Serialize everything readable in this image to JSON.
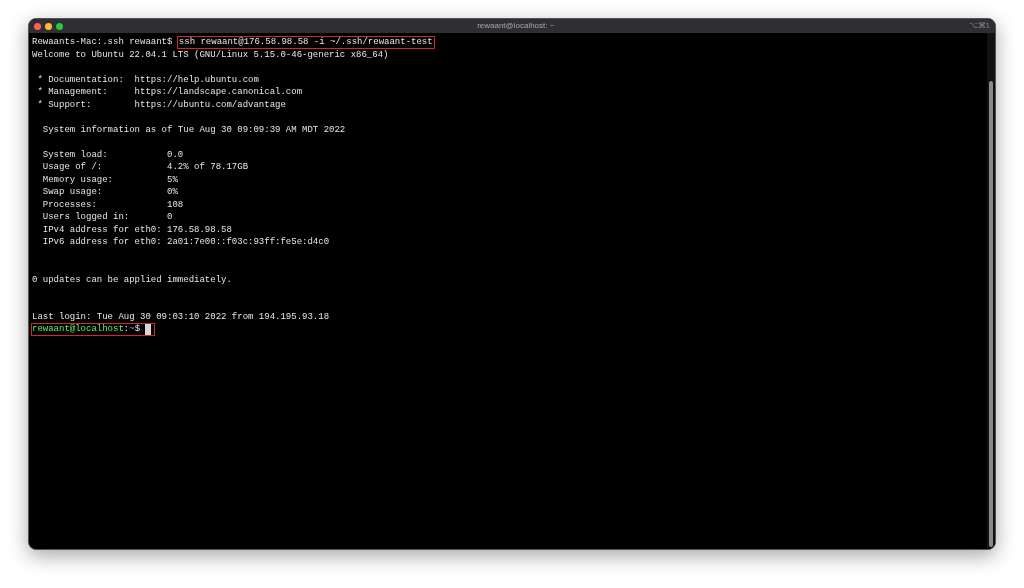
{
  "window": {
    "title": "rewaant@localhost: ~",
    "shortcut": "⌥⌘1"
  },
  "lines": [
    {
      "kind": "command",
      "prompt": "Rewaants-Mac:.ssh rewaant$",
      "command": "ssh rewaant@176.58.98.58 -i ~/.ssh/rewaant-test",
      "highlighted": true
    },
    {
      "kind": "output",
      "text": "Welcome to Ubuntu 22.04.1 LTS (GNU/Linux 5.15.0-46-generic x86_64)"
    },
    {
      "kind": "blank"
    },
    {
      "kind": "output",
      "text": " * Documentation:  https://help.ubuntu.com"
    },
    {
      "kind": "output",
      "text": " * Management:     https://landscape.canonical.com"
    },
    {
      "kind": "output",
      "text": " * Support:        https://ubuntu.com/advantage"
    },
    {
      "kind": "blank"
    },
    {
      "kind": "output",
      "text": "  System information as of Tue Aug 30 09:09:39 AM MDT 2022"
    },
    {
      "kind": "blank"
    },
    {
      "kind": "output",
      "text": "  System load:           0.0"
    },
    {
      "kind": "output",
      "text": "  Usage of /:            4.2% of 78.17GB"
    },
    {
      "kind": "output",
      "text": "  Memory usage:          5%"
    },
    {
      "kind": "output",
      "text": "  Swap usage:            0%"
    },
    {
      "kind": "output",
      "text": "  Processes:             108"
    },
    {
      "kind": "output",
      "text": "  Users logged in:       0"
    },
    {
      "kind": "output",
      "text": "  IPv4 address for eth0: 176.58.98.58"
    },
    {
      "kind": "output",
      "text": "  IPv6 address for eth0: 2a01:7e00::f03c:93ff:fe5e:d4c0"
    },
    {
      "kind": "blank"
    },
    {
      "kind": "blank"
    },
    {
      "kind": "output",
      "text": "0 updates can be applied immediately."
    },
    {
      "kind": "blank"
    },
    {
      "kind": "blank"
    },
    {
      "kind": "output",
      "text": "Last login: Tue Aug 30 09:03:10 2022 from 194.195.93.18"
    },
    {
      "kind": "prompt",
      "parts": [
        {
          "kind": "user_host",
          "text": "rewaant@localhost"
        },
        {
          "kind": "plain",
          "text": ":"
        },
        {
          "kind": "path",
          "text": "~"
        },
        {
          "kind": "plain",
          "text": "$"
        }
      ],
      "highlighted": true
    }
  ]
}
